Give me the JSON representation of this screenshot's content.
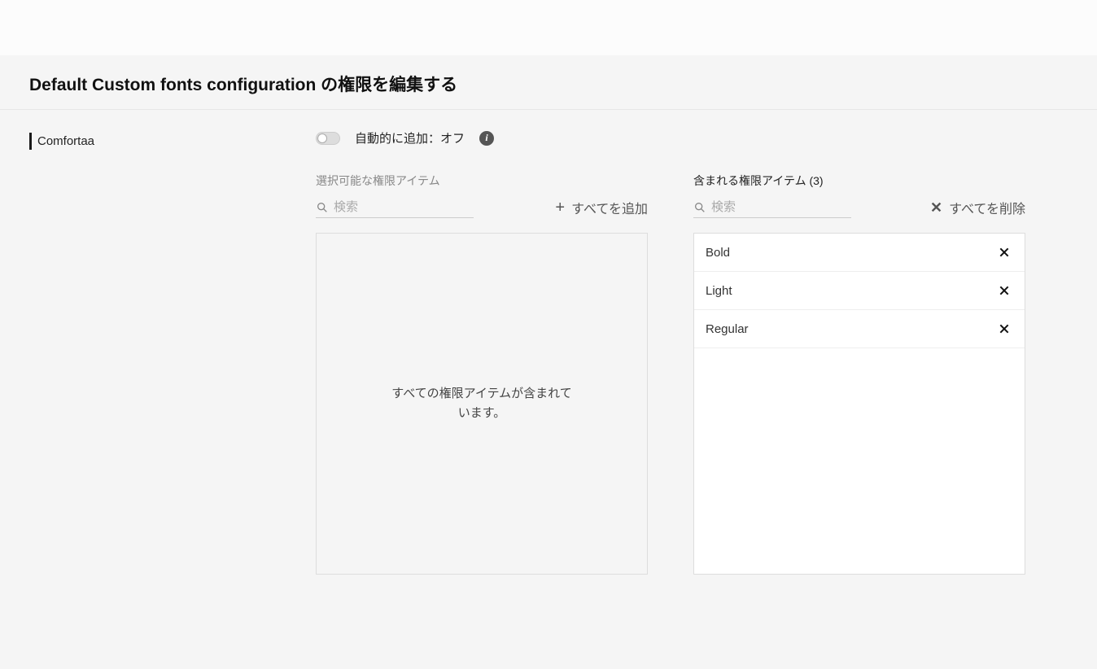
{
  "header": {
    "title": "Default Custom fonts configuration の権限を編集する"
  },
  "sidebar": {
    "items": [
      {
        "label": "Comfortaa"
      }
    ]
  },
  "toggle": {
    "label": "自動的に追加：オフ",
    "state": "off"
  },
  "left": {
    "heading": "選択可能な権限アイテム",
    "search_placeholder": "検索",
    "bulk_label": "すべてを追加",
    "empty_message": "すべての権限アイテムが含まれています。"
  },
  "right": {
    "heading": "含まれる権限アイテム (3)",
    "search_placeholder": "検索",
    "bulk_label": "すべてを削除",
    "items": [
      {
        "label": "Bold"
      },
      {
        "label": "Light"
      },
      {
        "label": "Regular"
      }
    ]
  }
}
